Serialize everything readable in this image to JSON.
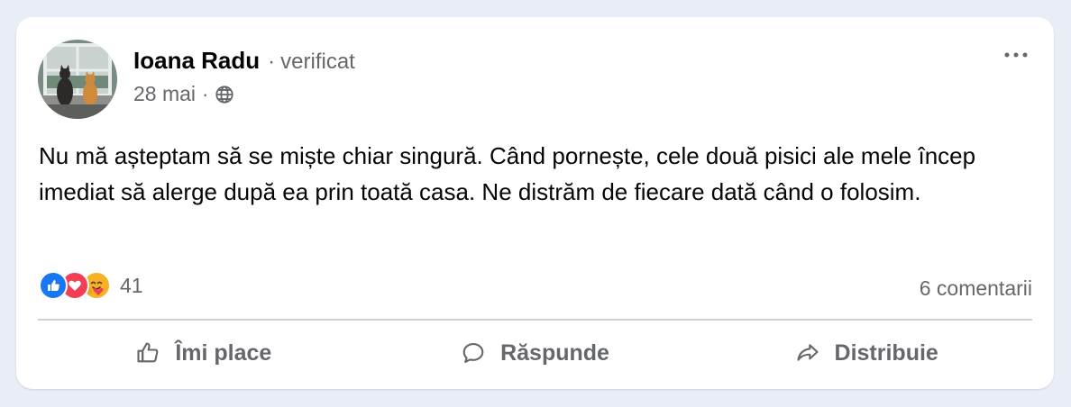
{
  "post": {
    "author": {
      "name": "Ioana Radu",
      "separator": "·",
      "badge": "verificat"
    },
    "meta": {
      "date": "28 mai",
      "separator": "·",
      "audience_icon": "globe-icon"
    },
    "more_icon": "more-horizontal-icon",
    "text": "Nu mă așteptam să se miște chiar singură. Când pornește, cele două pisici ale mele încep imediat să alerge după ea prin toată casa. Ne distrăm de fiecare dată când o folosim.",
    "reactions": {
      "icons": [
        "like-reaction-icon",
        "love-reaction-icon",
        "care-reaction-icon"
      ],
      "count": "41"
    },
    "comments_label": "6 comentarii",
    "actions": [
      {
        "label": "Îmi place",
        "icon": "thumbs-up-icon"
      },
      {
        "label": "Răspunde",
        "icon": "comment-icon"
      },
      {
        "label": "Distribuie",
        "icon": "share-icon"
      }
    ]
  },
  "colors": {
    "page_background": "#e9eef6",
    "card_background": "#ffffff",
    "primary_text": "#050505",
    "secondary_text": "#65676b",
    "like_blue": "#1877f2",
    "love_red": "#f33e58",
    "care_yellow": "#f7b125"
  }
}
